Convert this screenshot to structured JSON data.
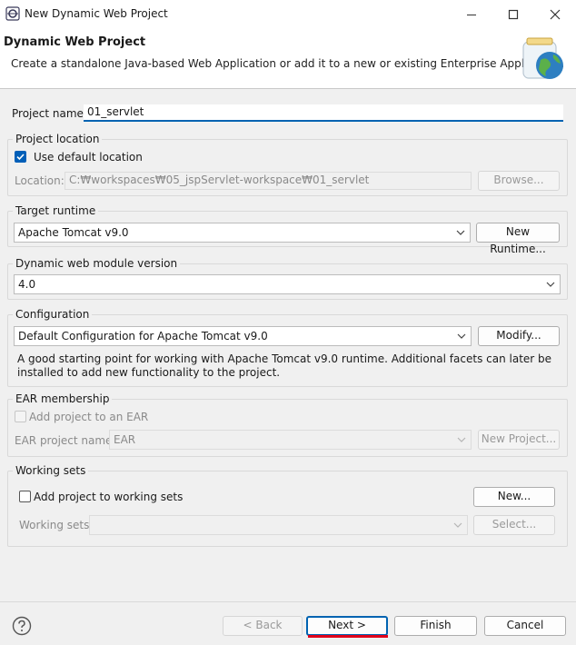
{
  "window": {
    "title": "New Dynamic Web Project",
    "controls": [
      "minimize-icon",
      "maximize-icon",
      "close-icon"
    ]
  },
  "header": {
    "title": "Dynamic Web Project",
    "description": "Create a standalone Java-based Web Application or add it to a new or existing Enterprise Application.",
    "icon": "web-project-jar-globe-icon"
  },
  "project_name": {
    "label": "Project name:",
    "value": "01_servlet"
  },
  "project_location": {
    "group_label": "Project location",
    "use_default_label": "Use default location",
    "use_default_checked": true,
    "location_label": "Location:",
    "location_value": "C:₩workspaces₩05_jspServlet-workspace₩01_servlet",
    "browse_label": "Browse..."
  },
  "target_runtime": {
    "group_label": "Target runtime",
    "selected": "Apache Tomcat v9.0",
    "new_runtime_label": "New Runtime..."
  },
  "module_version": {
    "group_label": "Dynamic web module version",
    "selected": "4.0"
  },
  "configuration": {
    "group_label": "Configuration",
    "selected": "Default Configuration for Apache Tomcat v9.0",
    "modify_label": "Modify...",
    "description": "A good starting point for working with Apache Tomcat v9.0 runtime. Additional facets can later be installed to add new functionality to the project."
  },
  "ear_membership": {
    "group_label": "EAR membership",
    "add_label": "Add project to an EAR",
    "add_checked": false,
    "ear_name_label": "EAR project name:",
    "ear_name_value": "EAR",
    "new_project_label": "New Project..."
  },
  "working_sets": {
    "group_label": "Working sets",
    "add_label": "Add project to working sets",
    "add_checked": false,
    "new_label": "New...",
    "sets_label": "Working sets:",
    "sets_value": "",
    "select_label": "Select..."
  },
  "footer": {
    "help_icon": "help-icon",
    "back_label": "< Back",
    "next_label": "Next >",
    "finish_label": "Finish",
    "cancel_label": "Cancel",
    "next_highlight_color": "#e0001b"
  },
  "colors": {
    "accent": "#005fb8",
    "focus_underline": "#0063b1"
  }
}
